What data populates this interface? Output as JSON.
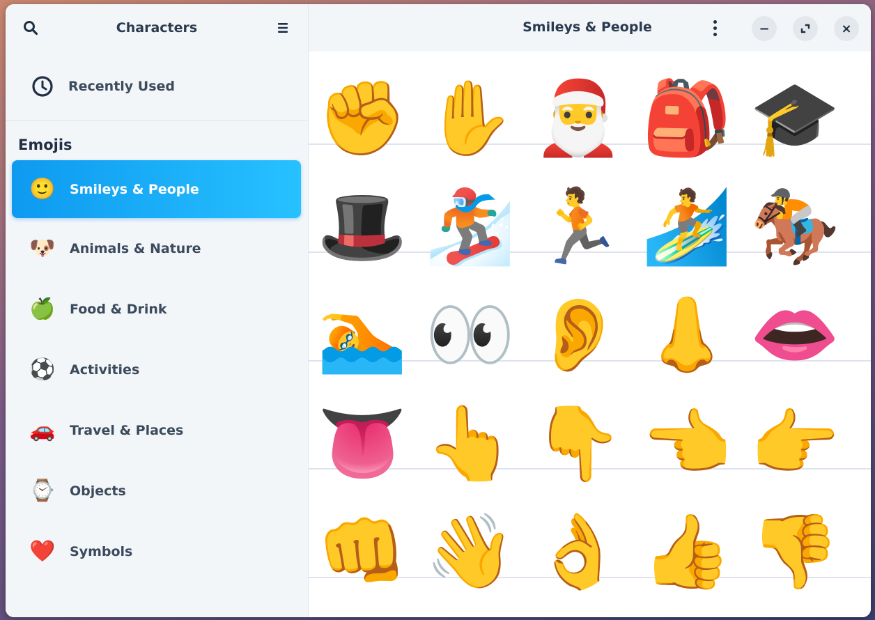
{
  "sidebar": {
    "title": "Characters",
    "recent_label": "Recently Used",
    "section_title": "Emojis",
    "categories": [
      {
        "label": "Smileys & People",
        "icon": "🙂"
      },
      {
        "label": "Animals & Nature",
        "icon": "🐶"
      },
      {
        "label": "Food & Drink",
        "icon": "🍏"
      },
      {
        "label": "Activities",
        "icon": "⚽"
      },
      {
        "label": "Travel & Places",
        "icon": "🚗"
      },
      {
        "label": "Objects",
        "icon": "⌚"
      },
      {
        "label": "Symbols",
        "icon": "❤️"
      }
    ]
  },
  "main": {
    "title": "Smileys & People",
    "emojis": [
      [
        "✊",
        "✋",
        "🎅",
        "🎒",
        "🎓"
      ],
      [
        "🎩",
        "🏂",
        "🏃",
        "🏄",
        "🏇"
      ],
      [
        "🏊",
        "👀",
        "👂",
        "👃",
        "👄"
      ],
      [
        "👅",
        "👆",
        "👇",
        "👈",
        "👉"
      ],
      [
        "👊",
        "👋",
        "👌",
        "👍",
        "👎"
      ]
    ]
  },
  "window_controls": {
    "minimize": "−",
    "close": "×"
  },
  "colors": {
    "accent": "#0e9af0",
    "sidebar_bg": "#f3f6f9"
  }
}
